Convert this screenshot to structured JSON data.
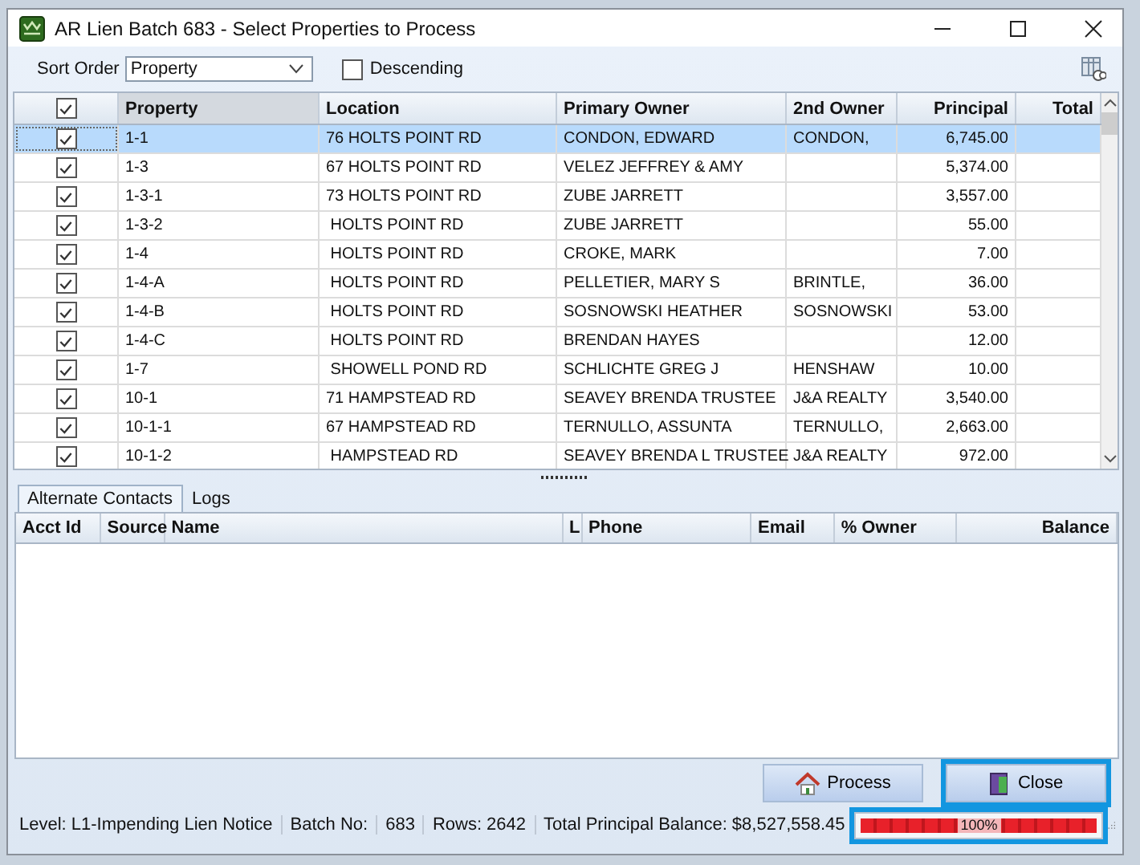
{
  "window": {
    "title": "AR Lien Batch 683 - Select Properties to Process"
  },
  "toolbar": {
    "sort_label": "Sort Order",
    "sort_value": "Property",
    "descending": {
      "label": "Descending",
      "checked": false
    }
  },
  "table": {
    "header_checked": true,
    "columns": [
      "Property",
      "Location",
      "Primary Owner",
      "2nd Owner",
      "Principal",
      "Total"
    ],
    "rows": [
      {
        "checked": true,
        "selected": true,
        "cells": [
          "1-1",
          "76 HOLTS POINT RD",
          "CONDON, EDWARD",
          "CONDON,",
          "6,745.00",
          ""
        ]
      },
      {
        "checked": true,
        "selected": false,
        "cells": [
          "1-3",
          "67 HOLTS POINT RD",
          "VELEZ JEFFREY & AMY",
          "",
          "5,374.00",
          ""
        ]
      },
      {
        "checked": true,
        "selected": false,
        "cells": [
          "1-3-1",
          "73 HOLTS POINT RD",
          "ZUBE JARRETT",
          "",
          "3,557.00",
          ""
        ]
      },
      {
        "checked": true,
        "selected": false,
        "cells": [
          "1-3-2",
          " HOLTS POINT RD",
          "ZUBE JARRETT",
          "",
          "55.00",
          ""
        ]
      },
      {
        "checked": true,
        "selected": false,
        "cells": [
          "1-4",
          " HOLTS POINT RD",
          "CROKE, MARK",
          "",
          "7.00",
          ""
        ]
      },
      {
        "checked": true,
        "selected": false,
        "cells": [
          "1-4-A",
          " HOLTS POINT RD",
          "PELLETIER, MARY S",
          "BRINTLE,",
          "36.00",
          ""
        ]
      },
      {
        "checked": true,
        "selected": false,
        "cells": [
          "1-4-B",
          " HOLTS POINT RD",
          "SOSNOWSKI HEATHER",
          "SOSNOWSKI",
          "53.00",
          ""
        ]
      },
      {
        "checked": true,
        "selected": false,
        "cells": [
          "1-4-C",
          " HOLTS POINT RD",
          "BRENDAN HAYES",
          "",
          "12.00",
          ""
        ]
      },
      {
        "checked": true,
        "selected": false,
        "cells": [
          "1-7",
          " SHOWELL POND RD",
          "SCHLICHTE GREG J",
          "HENSHAW",
          "10.00",
          ""
        ]
      },
      {
        "checked": true,
        "selected": false,
        "cells": [
          "10-1",
          "71 HAMPSTEAD RD",
          "SEAVEY BRENDA TRUSTEE",
          "J&A REALTY",
          "3,540.00",
          ""
        ]
      },
      {
        "checked": true,
        "selected": false,
        "cells": [
          "10-1-1",
          "67 HAMPSTEAD RD",
          "TERNULLO, ASSUNTA",
          "TERNULLO,",
          "2,663.00",
          ""
        ]
      },
      {
        "checked": true,
        "selected": false,
        "cells": [
          "10-1-2",
          " HAMPSTEAD RD",
          "SEAVEY BRENDA L TRUSTEE",
          "J&A REALTY",
          "972.00",
          ""
        ]
      }
    ]
  },
  "tabs": [
    {
      "label": "Alternate Contacts",
      "selected": true
    },
    {
      "label": "Logs",
      "selected": false
    }
  ],
  "contacts": {
    "columns": [
      "Acct Id",
      "Source",
      "Name",
      "L",
      "Phone",
      "Email",
      "% Owner",
      "Balance"
    ]
  },
  "buttons": [
    {
      "label": "Process",
      "kind": "process",
      "highlighted": false
    },
    {
      "label": "Close",
      "kind": "close",
      "highlighted": true
    }
  ],
  "status_bar": {
    "items": [
      "Level: L1-Impending Lien Notice",
      "Batch No:",
      "683",
      "Rows: 2642",
      "Total Principal Balance: $8,527,558.45"
    ],
    "progress": {
      "level": 1,
      "text": "100%",
      "highlighted": true
    }
  }
}
